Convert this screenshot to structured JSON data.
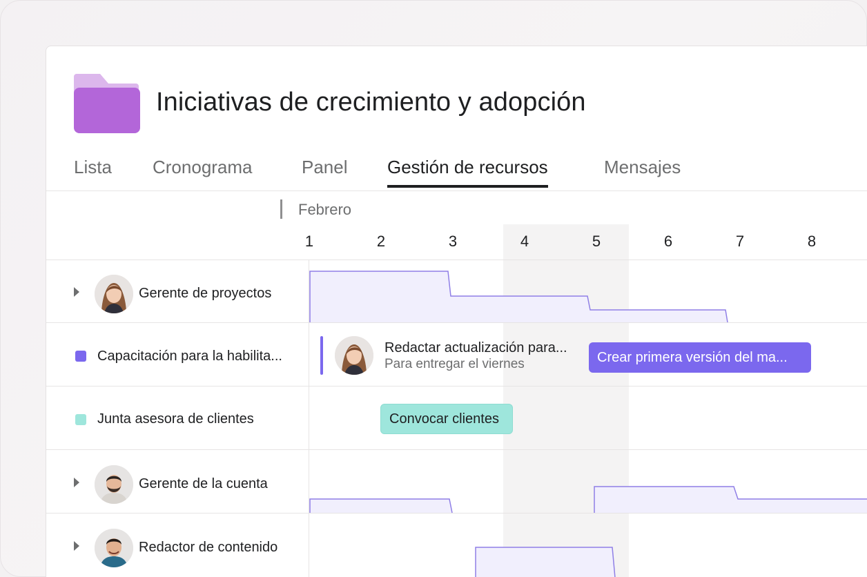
{
  "project": {
    "title": "Iniciativas de crecimiento y adopción",
    "folder_color": "#b366d9"
  },
  "tabs": [
    {
      "label": "Lista"
    },
    {
      "label": "Cronograma"
    },
    {
      "label": "Panel"
    },
    {
      "label": "Gestión de recursos",
      "active": true
    },
    {
      "label": "Mensajes"
    }
  ],
  "timeline": {
    "month": "Febrero",
    "days": [
      "1",
      "2",
      "3",
      "4",
      "5",
      "6",
      "7",
      "8"
    ]
  },
  "rows": [
    {
      "label": "Gerente de proyectos",
      "type": "person",
      "icon": "avatar-woman"
    },
    {
      "label": "Capacitación para la habilita...",
      "type": "project",
      "color": "#7b68ee"
    },
    {
      "label": "Junta asesora de clientes",
      "type": "project",
      "color": "#9ee6dc"
    },
    {
      "label": "Gerente de la cuenta",
      "type": "person",
      "icon": "avatar-man-beard"
    },
    {
      "label": "Redactor de contenido",
      "type": "person",
      "icon": "avatar-man-smile"
    }
  ],
  "tasks": {
    "draft_update": {
      "title": "Redactar actualización para...",
      "subtitle": "Para entregar el viernes"
    },
    "first_version": {
      "label": "Crear primera versión del ma...",
      "color": "#7b68ee"
    },
    "convene_clients": {
      "label": "Convocar clientes",
      "color": "#9ee6dc"
    }
  },
  "colors": {
    "accent": "#7b68ee",
    "workload_fill": "#f1effd",
    "workload_stroke": "#8f7fe6"
  }
}
